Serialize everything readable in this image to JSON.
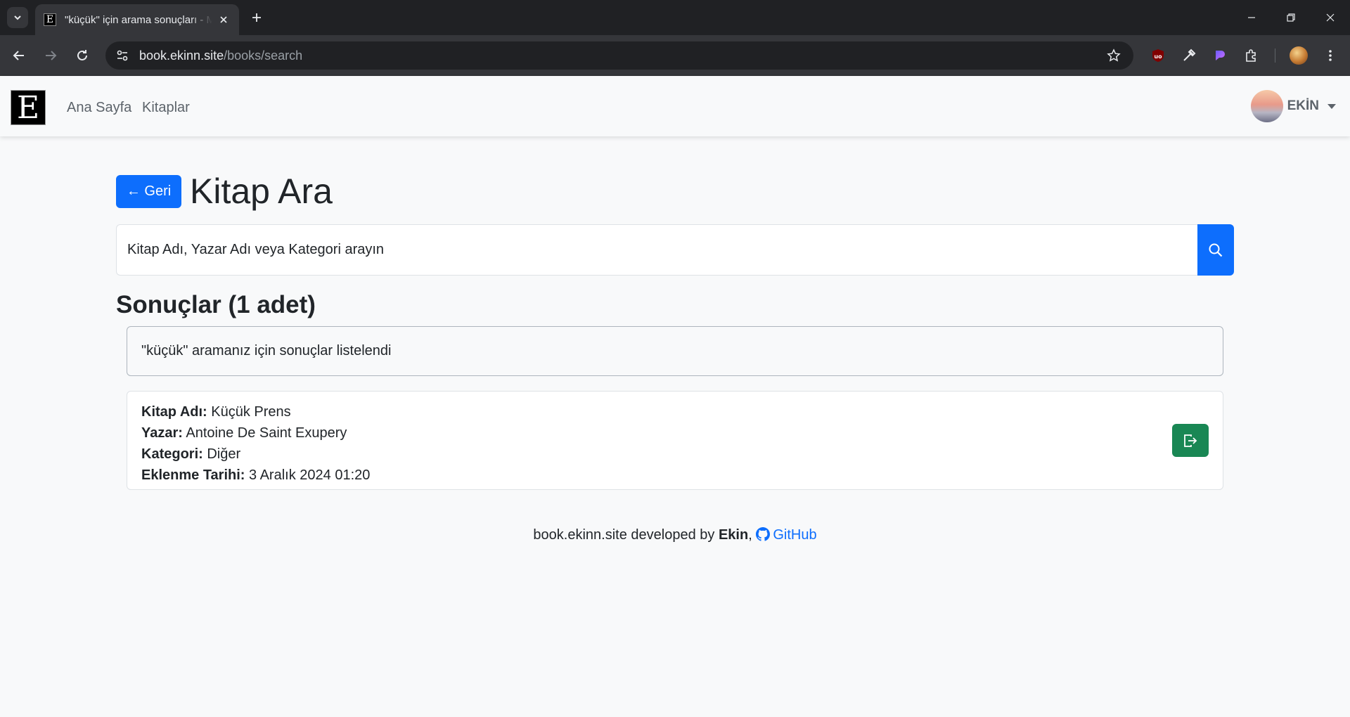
{
  "browser": {
    "tab_title": "\"küçük\" için arama sonuçları - M",
    "url_host": "book.ekinn.site",
    "url_path": "/books/search"
  },
  "nav": {
    "brand_letter": "E",
    "links": [
      "Ana Sayfa",
      "Kitaplar"
    ],
    "user_name": "EKİN"
  },
  "page": {
    "back_label": "← Geri",
    "title": "Kitap Ara",
    "search_placeholder": "Kitap Adı, Yazar Adı veya Kategori arayın",
    "results_title": "Sonuçlar (1 adet)",
    "alert_text": "\"küçük\" aramanız için sonuçlar listelendi"
  },
  "books": [
    {
      "fields": [
        {
          "label": "Kitap Adı:",
          "value": "Küçük Prens"
        },
        {
          "label": "Yazar:",
          "value": "Antoine De Saint Exupery"
        },
        {
          "label": "Kategori:",
          "value": "Diğer"
        },
        {
          "label": "Eklenme Tarihi:",
          "value": "3 Aralık 2024 01:20"
        }
      ]
    }
  ],
  "footer": {
    "site": "book.ekinn.site",
    "developed_by": "developed by",
    "author": "Ekin",
    "comma": ",",
    "github_label": "GitHub"
  },
  "colors": {
    "primary": "#0d6efd",
    "success": "#198754",
    "page_bg": "#f8f9fa"
  }
}
